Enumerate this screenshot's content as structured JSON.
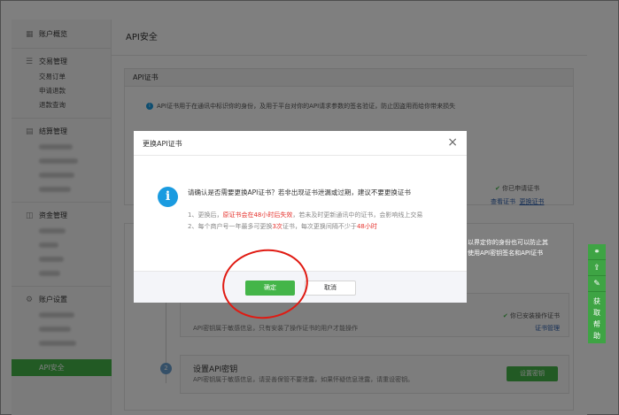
{
  "sidebar": {
    "groups": [
      {
        "label": "账户概览",
        "icon": "grid-icon",
        "items": []
      },
      {
        "label": "交易管理",
        "icon": "list-icon",
        "items": [
          "交易订单",
          "申请退款",
          "退款查询"
        ]
      },
      {
        "label": "结算管理",
        "icon": "ledger-icon",
        "items": []
      },
      {
        "label": "资金管理",
        "icon": "wallet-icon",
        "items": []
      },
      {
        "label": "账户设置",
        "icon": "gear-icon",
        "items": []
      }
    ],
    "active_item": "API安全"
  },
  "main": {
    "page_title": "API安全",
    "cert_card": {
      "title": "API证书",
      "info": "API证书用于在通讯中标识你的身份，及用于平台对你的API请求参数的签名验证，防止因盗用而给你带来损失",
      "status": "你已申请证书",
      "link_view": "查看证书",
      "link_replace": "更换证书"
    },
    "key_card": {
      "right_text_1": "以界定你的身份也可以防止其",
      "right_text_2": "使用API密钥签名和API证书",
      "step1_desc": "API密钥属于敏感信息，只有安装了操作证书的用户才能操作",
      "step1_status": "你已安装操作证书",
      "step1_link": "证书管理",
      "step2_num": "2",
      "step2_title": "设置API密钥",
      "step2_desc": "API密钥属于敏感信息，请妥善保管不要泄露，如果怀疑信息泄露，请重设密钥。",
      "step2_button": "设置密钥"
    }
  },
  "dialog": {
    "title": "更换API证书",
    "close": "×",
    "question": "请确认是否需要更换API证书？若非出现证书泄漏或过期，建议不要更换证书",
    "line1_prefix": "1、更换后，",
    "line1_red": "原证书会在48小时后失效",
    "line1_suffix": "，若未及时更新通讯中的证书，会影响线上交易",
    "line2_prefix": "2、每个商户号一年最多可更换",
    "line2_red": "3次",
    "line2_mid": "证书，每次更换间隔不少于",
    "line2_red2": "48小时",
    "confirm": "确定",
    "cancel": "取消"
  },
  "right_tools": {
    "label": "获取帮助"
  }
}
